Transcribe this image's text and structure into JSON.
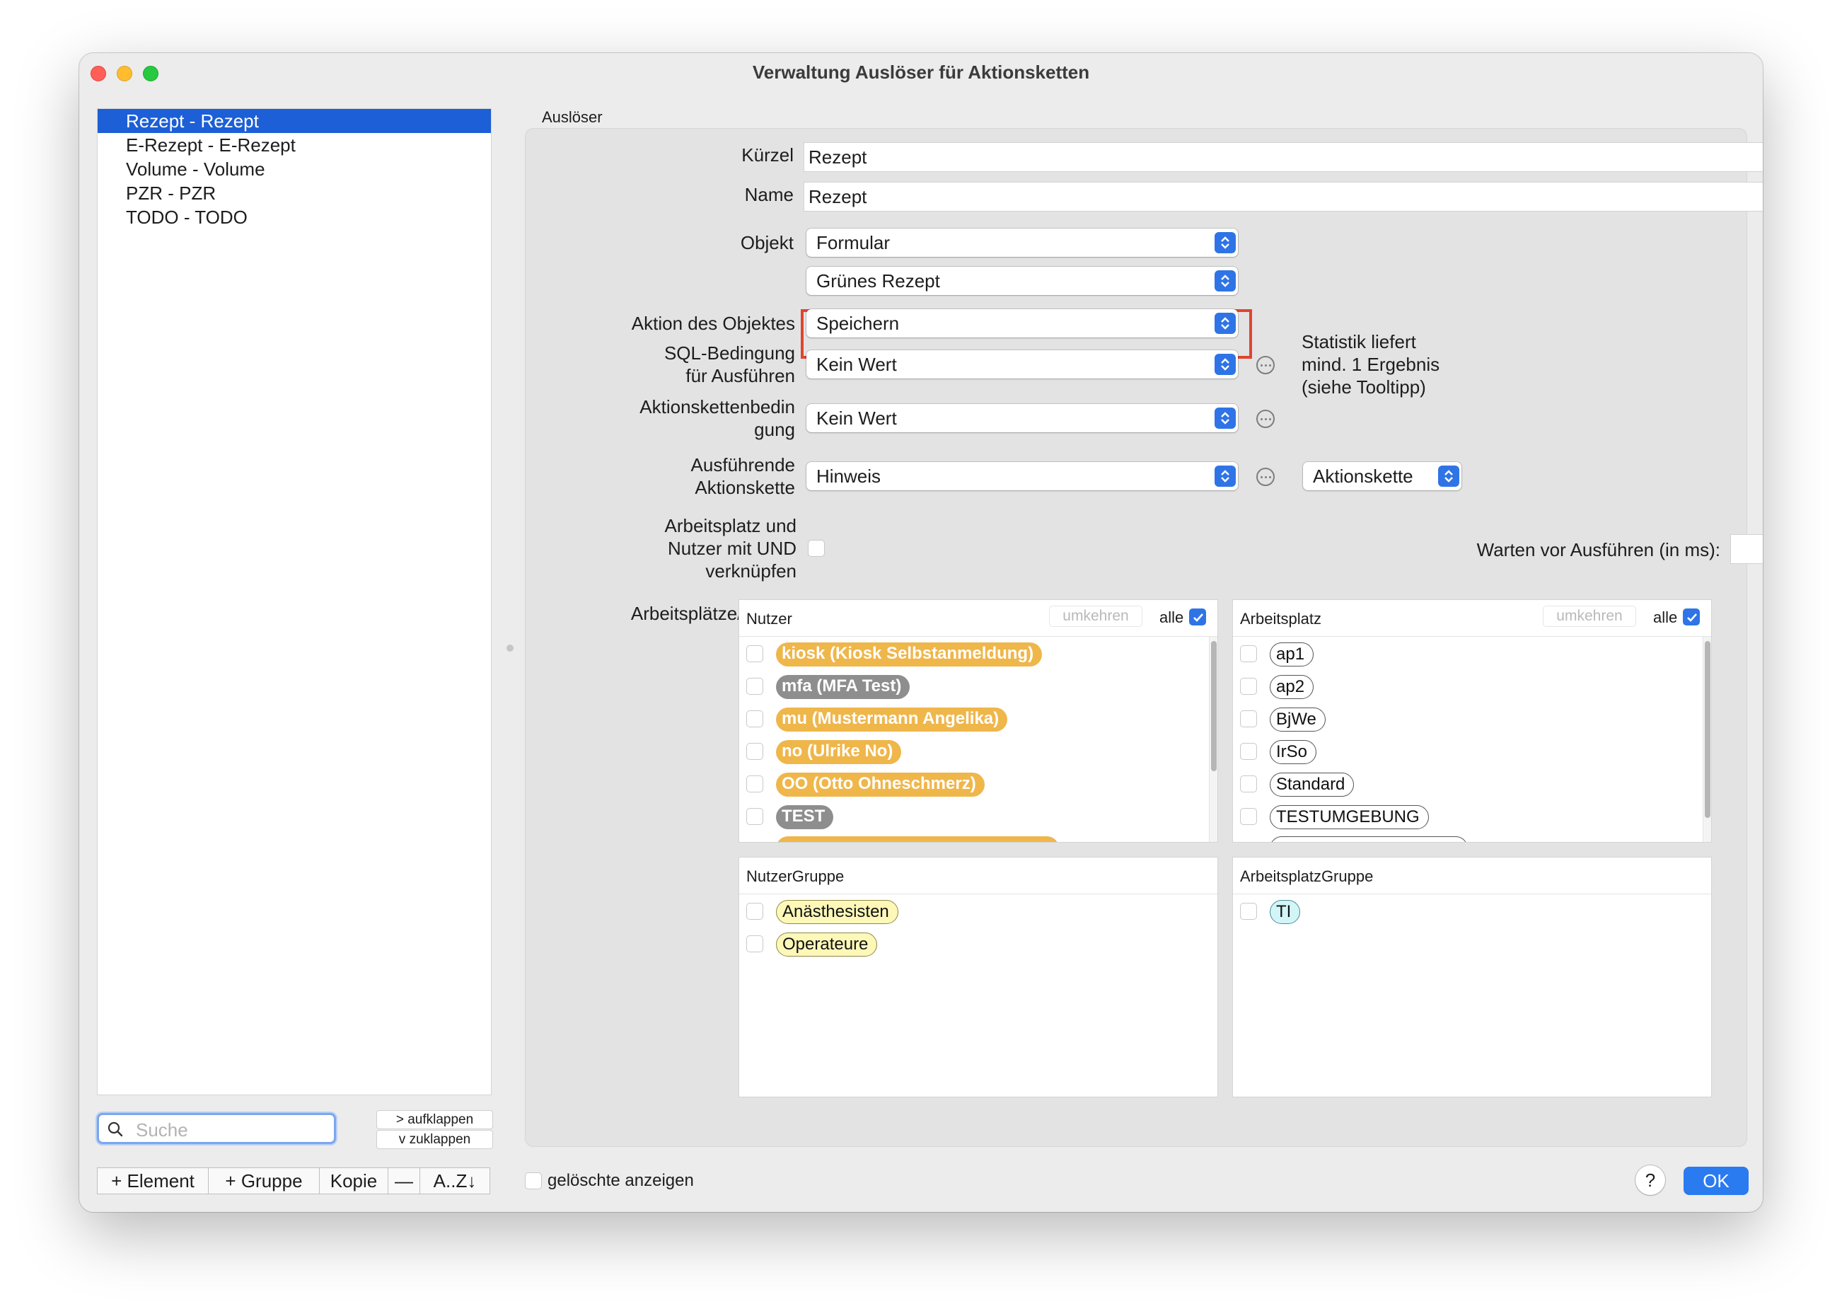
{
  "window": {
    "title": "Verwaltung Auslöser für Aktionsketten"
  },
  "sidebar": {
    "items": [
      {
        "label": "Rezept - Rezept",
        "selected": true
      },
      {
        "label": "E-Rezept - E-Rezept",
        "selected": false
      },
      {
        "label": "Volume - Volume",
        "selected": false
      },
      {
        "label": "PZR - PZR",
        "selected": false
      },
      {
        "label": "TODO - TODO",
        "selected": false
      }
    ],
    "search_placeholder": "Suche",
    "expand_label": "> aufklappen",
    "collapse_label": "v  zuklappen",
    "buttons": {
      "add_element": "+ Element",
      "add_group": "+ Gruppe",
      "copy": "Kopie",
      "remove": "—",
      "sort": "A..Z↓"
    }
  },
  "form": {
    "group_label": "Auslöser",
    "kuerzel_label": "Kürzel",
    "kuerzel_value": "Rezept",
    "name_label": "Name",
    "name_value": "Rezept",
    "objekt_label": "Objekt",
    "objekt_value": "Formular",
    "objekt_sub_value": "Grünes Rezept",
    "aktion_label": "Aktion des Objektes",
    "aktion_value": "Speichern",
    "sql_label_1": "SQL-Bedingung",
    "sql_label_2": "für Ausführen",
    "sql_value": "Kein Wert",
    "stat_note_1": "Statistik liefert",
    "stat_note_2": "mind. 1 Ergebnis",
    "stat_note_3": "(siehe Tooltipp)",
    "ak_bed_label_1": "Aktionskettenbedin",
    "ak_bed_label_2": "gung",
    "ak_bed_value": "Kein Wert",
    "ausf_label_1": "Ausführende",
    "ausf_label_2": "Aktionskette",
    "ausf_value": "Hinweis",
    "ausf_type_value": "Aktionskette",
    "und_label_1": "Arbeitsplatz und",
    "und_label_2": "Nutzer mit UND",
    "und_label_3": "verknüpfen",
    "und_checked": false,
    "warten_label": "Warten vor Ausführen (in ms):",
    "warten_value": "",
    "ap_nutzer_label": "Arbeitsplätze/Nutzer"
  },
  "panels": {
    "nutzer": {
      "title": "Nutzer",
      "invert_label": "umkehren",
      "all_label": "alle",
      "all_checked": true,
      "items": [
        {
          "label": "kiosk (Kiosk Selbstanmeldung)",
          "style": "orange"
        },
        {
          "label": "mfa (MFA Test)",
          "style": "gray"
        },
        {
          "label": "mu (Mustermann Angelika)",
          "style": "orange"
        },
        {
          "label": "no (Ulrike No)",
          "style": "orange"
        },
        {
          "label": "OO (Otto Ohneschmerz)",
          "style": "orange"
        },
        {
          "label": "TEST",
          "style": "gray"
        }
      ]
    },
    "arbeitsplatz": {
      "title": "Arbeitsplatz",
      "invert_label": "umkehren",
      "all_label": "alle",
      "all_checked": true,
      "items": [
        {
          "label": "ap1"
        },
        {
          "label": "ap2"
        },
        {
          "label": "BjWe"
        },
        {
          "label": "IrSo"
        },
        {
          "label": "Standard"
        },
        {
          "label": "TESTUMGEBUNG"
        }
      ]
    },
    "nutzergruppe": {
      "title": "NutzerGruppe",
      "items": [
        {
          "label": "Anästhesisten"
        },
        {
          "label": "Operateure"
        }
      ]
    },
    "arbeitsplatzgruppe": {
      "title": "ArbeitsplatzGruppe",
      "items": [
        {
          "label": "TI"
        }
      ]
    }
  },
  "footer": {
    "show_deleted_label": "gelöschte anzeigen",
    "show_deleted_checked": false,
    "help_label": "?",
    "ok_label": "OK"
  },
  "colors": {
    "accent": "#2f74e6",
    "selection": "#1c5fd6",
    "highlight_box": "#e0442f",
    "pill_orange": "#efb64a",
    "pill_gray": "#8e8e8e"
  }
}
